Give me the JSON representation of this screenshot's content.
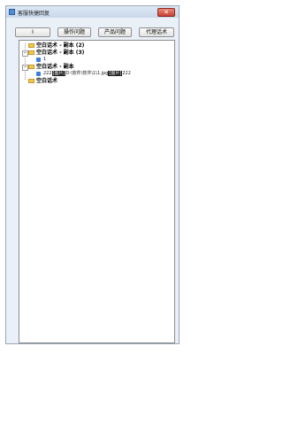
{
  "window": {
    "title": "客服快捷回复",
    "close_label": "✕"
  },
  "toolbar": {
    "btn1": "I",
    "btn2": "操作问题",
    "btn3": "产品问题",
    "btn4": "代理话术"
  },
  "tree": {
    "n1": "空白话术 - 副本 (2)",
    "n2": "空白话术 - 副本 (3)",
    "n2_child": "1",
    "n3": "空白话术 - 副本",
    "n3_child_pre": "222",
    "n3_child_hl1": "[图片]",
    "n3_child_mid": "D:\\软件\\软件\\1\\1.jpg",
    "n3_child_hl2": "[图片]",
    "n3_child_post": "222",
    "n4": "空白话术"
  }
}
